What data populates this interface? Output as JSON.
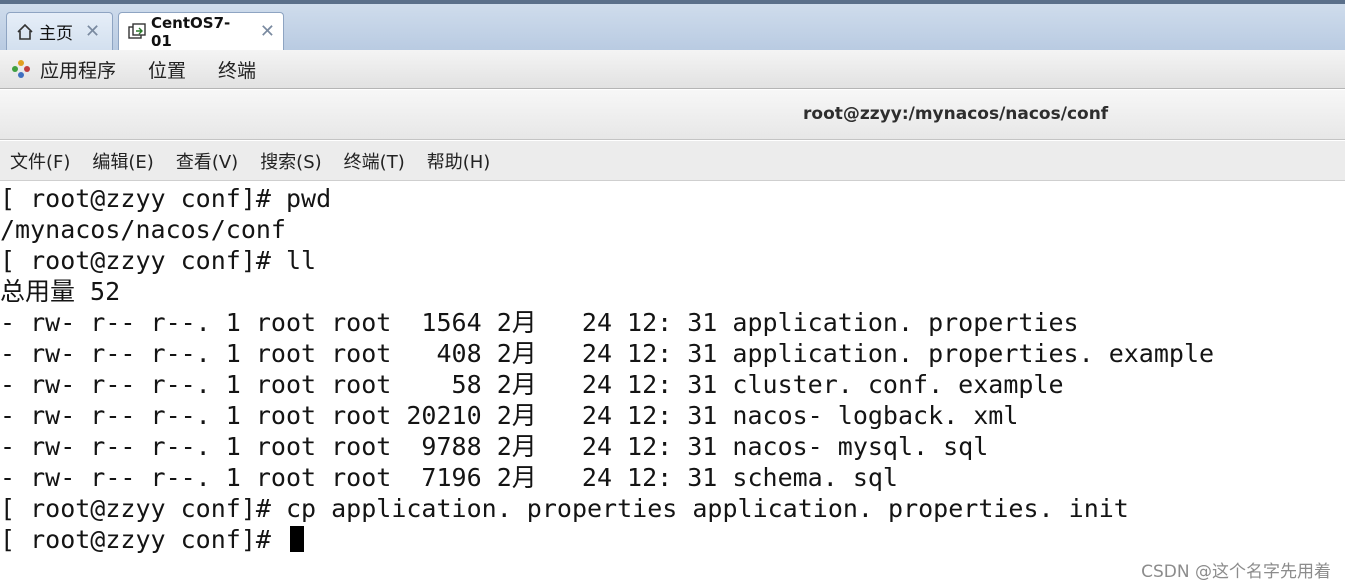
{
  "tabs": [
    {
      "label": "主页",
      "icon": "home-icon",
      "active": false
    },
    {
      "label": "CentOS7-01",
      "icon": "vm-icon",
      "active": true
    }
  ],
  "gnome_panel": {
    "applications": "应用程序",
    "places": "位置",
    "terminal": "终端"
  },
  "window": {
    "title": "root@zzyy:/mynacos/nacos/conf"
  },
  "menu": [
    "文件(F)",
    "编辑(E)",
    "查看(V)",
    "搜索(S)",
    "终端(T)",
    "帮助(H)"
  ],
  "terminal": {
    "lines": [
      "[ root@zzyy conf]# pwd",
      "/mynacos/nacos/conf",
      "[ root@zzyy conf]# ll",
      "总用量 52",
      "- rw- r-- r--. 1 root root  1564 2月   24 12: 31 application. properties",
      "- rw- r-- r--. 1 root root   408 2月   24 12: 31 application. properties. example",
      "- rw- r-- r--. 1 root root    58 2月   24 12: 31 cluster. conf. example",
      "- rw- r-- r--. 1 root root 20210 2月   24 12: 31 nacos- logback. xml",
      "- rw- r-- r--. 1 root root  9788 2月   24 12: 31 nacos- mysql. sql",
      "- rw- r-- r--. 1 root root  7196 2月   24 12: 31 schema. sql",
      "[ root@zzyy conf]# cp application. properties application. properties. init",
      "[ root@zzyy conf]# "
    ]
  },
  "watermark": "CSDN @这个名字先用着"
}
